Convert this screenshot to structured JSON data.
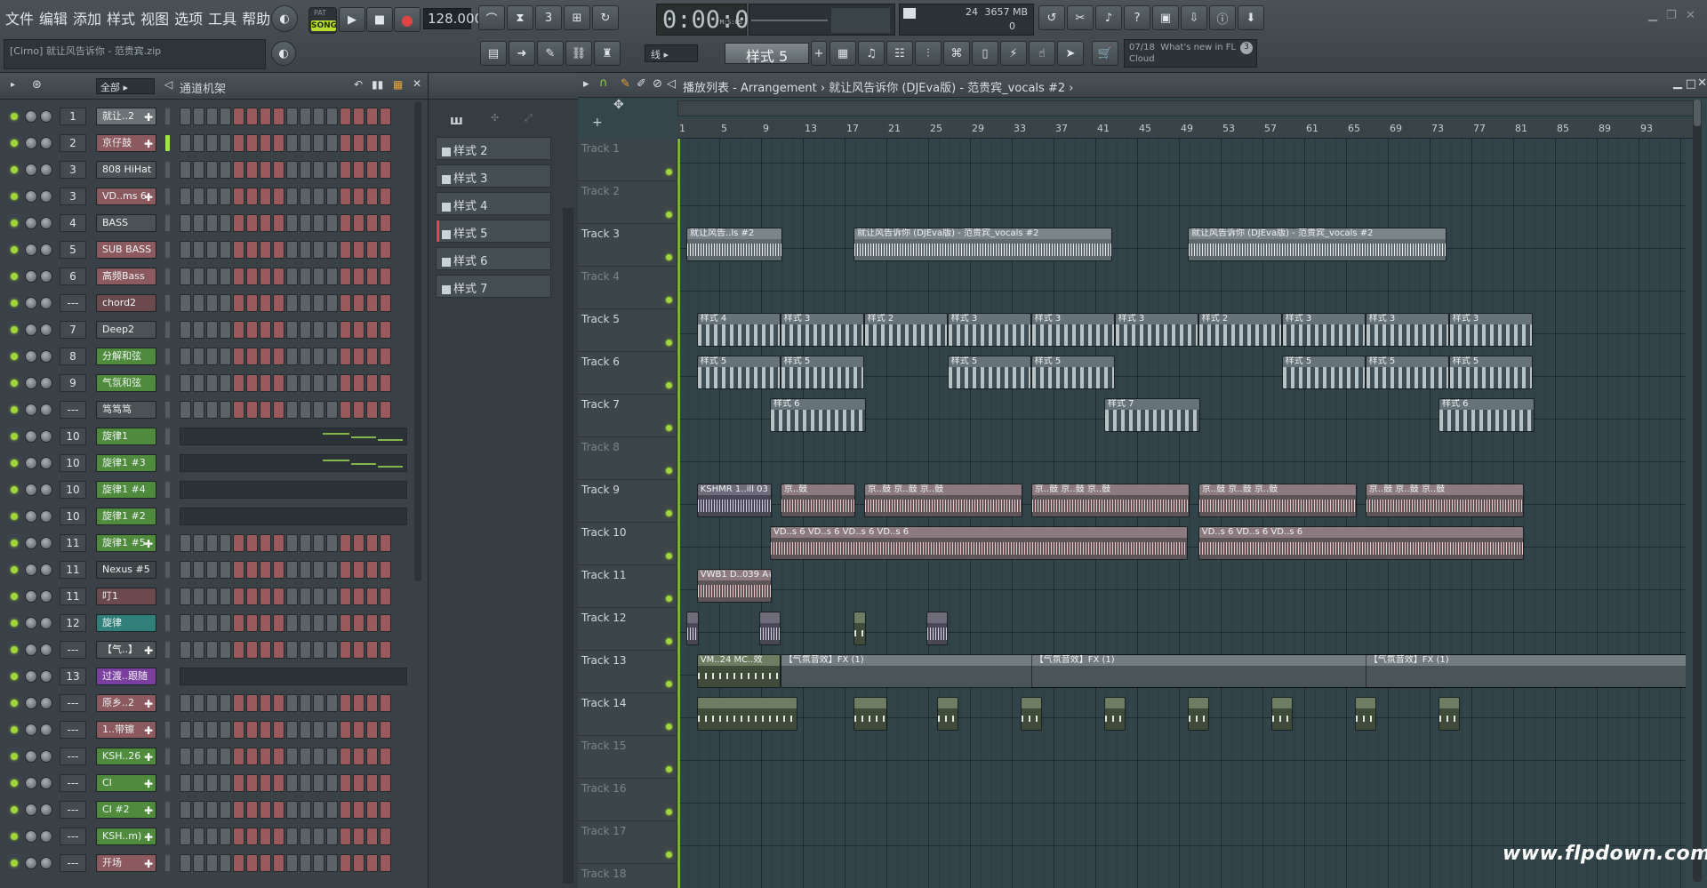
{
  "menu": [
    "文件",
    "编辑",
    "添加",
    "样式",
    "视图",
    "选项",
    "工具",
    "帮助"
  ],
  "hint": "[Cirno] 就让风告诉你 - 范贵宾.zip",
  "transport": {
    "mode": "SONG",
    "mode_top": "PAT",
    "tempo": "128.000",
    "time": "0:00:00",
    "time_unit": "M:S:CS"
  },
  "cpu": {
    "value": "24",
    "memory": "3657 MB",
    "poly": "0"
  },
  "snap": "线",
  "pattern_selector": "样式 5",
  "news": {
    "date": "07/18",
    "text": "What's new in FL Cloud",
    "count": "3"
  },
  "rack": {
    "filter": "全部",
    "title": "通道机架",
    "channels": [
      {
        "num": "1",
        "name": "就让..2",
        "color": "#6b7377",
        "plugin": true,
        "pattern": "steps"
      },
      {
        "num": "2",
        "name": "京仔鼓",
        "color": "#8a5a5e",
        "plugin": true,
        "pattern": "steps"
      },
      {
        "num": "3",
        "name": "808 HiHat",
        "color": "#4a5256",
        "plugin": false,
        "pattern": "steps"
      },
      {
        "num": "3",
        "name": "VD..ms 6",
        "color": "#8a5a5e",
        "plugin": true,
        "pattern": "steps"
      },
      {
        "num": "4",
        "name": "BASS",
        "color": "#4a5256",
        "plugin": false,
        "pattern": "steps"
      },
      {
        "num": "5",
        "name": "SUB BASS",
        "color": "#8a5a5e",
        "plugin": false,
        "pattern": "steps"
      },
      {
        "num": "6",
        "name": "高频Bass",
        "color": "#8a5a5e",
        "plugin": false,
        "pattern": "steps"
      },
      {
        "num": "---",
        "name": "chord2",
        "color": "#6b4a4e",
        "plugin": false,
        "pattern": "steps"
      },
      {
        "num": "7",
        "name": "Deep2",
        "color": "#4a5256",
        "plugin": false,
        "pattern": "steps"
      },
      {
        "num": "8",
        "name": "分解和弦",
        "color": "#4f8a3d",
        "plugin": false,
        "pattern": "steps"
      },
      {
        "num": "9",
        "name": "气氛和弦",
        "color": "#4f8a3d",
        "plugin": false,
        "pattern": "steps"
      },
      {
        "num": "---",
        "name": "笃笃笃",
        "color": "#4a5256",
        "plugin": false,
        "pattern": "steps"
      },
      {
        "num": "10",
        "name": "旋律1",
        "color": "#4f8a3d",
        "plugin": false,
        "pattern": "roll"
      },
      {
        "num": "10",
        "name": "旋律1 #3",
        "color": "#4f8a3d",
        "plugin": false,
        "pattern": "roll"
      },
      {
        "num": "10",
        "name": "旋律1 #4",
        "color": "#4f8a3d",
        "plugin": false,
        "pattern": "roll"
      },
      {
        "num": "10",
        "name": "旋律1 #2",
        "color": "#4f8a3d",
        "plugin": false,
        "pattern": "roll"
      },
      {
        "num": "11",
        "name": "旋律1 #5",
        "color": "#4f8a3d",
        "plugin": true,
        "pattern": "steps"
      },
      {
        "num": "11",
        "name": "Nexus #5",
        "color": "#3d4448",
        "plugin": false,
        "pattern": "steps"
      },
      {
        "num": "11",
        "name": "叮1",
        "color": "#6b4a4e",
        "plugin": false,
        "pattern": "steps"
      },
      {
        "num": "12",
        "name": "旋律",
        "color": "#2f7f7a",
        "plugin": false,
        "pattern": "steps"
      },
      {
        "num": "---",
        "name": "【气..】",
        "color": "#4a5256",
        "plugin": true,
        "pattern": "steps"
      },
      {
        "num": "13",
        "name": "过渡..跟随",
        "color": "#7b3fa0",
        "plugin": false,
        "pattern": "roll"
      },
      {
        "num": "---",
        "name": "原乡..2",
        "color": "#8a5a5e",
        "plugin": true,
        "pattern": "steps"
      },
      {
        "num": "---",
        "name": "1..带镲",
        "color": "#8a5a5e",
        "plugin": true,
        "pattern": "steps"
      },
      {
        "num": "---",
        "name": "KSH..26",
        "color": "#4f8a3d",
        "plugin": true,
        "pattern": "steps"
      },
      {
        "num": "---",
        "name": "CI",
        "color": "#4f8a3d",
        "plugin": true,
        "pattern": "steps"
      },
      {
        "num": "---",
        "name": "CI #2",
        "color": "#4f8a3d",
        "plugin": true,
        "pattern": "steps"
      },
      {
        "num": "---",
        "name": "KSH..m)",
        "color": "#4f8a3d",
        "plugin": true,
        "pattern": "steps"
      },
      {
        "num": "---",
        "name": "开场",
        "color": "#8a5a5e",
        "plugin": true,
        "pattern": "steps"
      }
    ]
  },
  "picker": [
    "样式 2",
    "样式 3",
    "样式 4",
    "样式 5",
    "样式 6",
    "样式 7"
  ],
  "playlist": {
    "title": "播放列表 - Arrangement › 就让风告诉你 (DJEva版) - 范贵宾_vocals #2 ›",
    "ruler": [
      "1",
      "5",
      "9",
      "13",
      "17",
      "21",
      "25",
      "29",
      "33",
      "37",
      "41",
      "45",
      "49",
      "53",
      "57",
      "61",
      "65",
      "69",
      "73",
      "77",
      "81",
      "85",
      "89",
      "93"
    ],
    "tracks": [
      "Track 1",
      "Track 2",
      "Track 3",
      "Track 4",
      "Track 5",
      "Track 6",
      "Track 7",
      "Track 8",
      "Track 9",
      "Track 10",
      "Track 11",
      "Track 12",
      "Track 13",
      "Track 14",
      "Track 15",
      "Track 16",
      "Track 17",
      "Track 18"
    ],
    "clips": [
      {
        "track": 3,
        "bar": 1,
        "len": 2.3,
        "style": "audio",
        "label": "就让风告..ls #2"
      },
      {
        "track": 3,
        "bar": 17,
        "len": 6.2,
        "style": "audio",
        "label": "就让风告诉你 (DJEva版) - 范贵宾_vocals #2"
      },
      {
        "track": 3,
        "bar": 49,
        "len": 6.2,
        "style": "audio",
        "label": "就让风告诉你 (DJEva版) - 范贵宾_vocals #2"
      },
      {
        "track": 5,
        "bar": 2,
        "len": 2,
        "style": "pat",
        "label": "样式 4"
      },
      {
        "track": 5,
        "bar": 10,
        "len": 2,
        "style": "pat",
        "label": "样式 3"
      },
      {
        "track": 5,
        "bar": 18,
        "len": 2,
        "style": "pat",
        "label": "样式 2"
      },
      {
        "track": 5,
        "bar": 26,
        "len": 2,
        "style": "pat",
        "label": "样式 3"
      },
      {
        "track": 5,
        "bar": 34,
        "len": 2,
        "style": "pat",
        "label": "样式 3"
      },
      {
        "track": 5,
        "bar": 42,
        "len": 2,
        "style": "pat",
        "label": "样式 3"
      },
      {
        "track": 5,
        "bar": 50,
        "len": 2,
        "style": "pat",
        "label": "样式 2"
      },
      {
        "track": 5,
        "bar": 58,
        "len": 2,
        "style": "pat",
        "label": "样式 3"
      },
      {
        "track": 5,
        "bar": 66,
        "len": 2,
        "style": "pat",
        "label": "样式 3"
      },
      {
        "track": 5,
        "bar": 74,
        "len": 2,
        "style": "pat",
        "label": "样式 3"
      },
      {
        "track": 6,
        "bar": 2,
        "len": 2,
        "style": "pat",
        "label": "样式 5"
      },
      {
        "track": 6,
        "bar": 10,
        "len": 2,
        "style": "pat",
        "label": "样式 5"
      },
      {
        "track": 6,
        "bar": 26,
        "len": 2,
        "style": "pat",
        "label": "样式 5"
      },
      {
        "track": 6,
        "bar": 34,
        "len": 2,
        "style": "pat",
        "label": "样式 5"
      },
      {
        "track": 6,
        "bar": 58,
        "len": 2,
        "style": "pat",
        "label": "样式 5"
      },
      {
        "track": 6,
        "bar": 66,
        "len": 2,
        "style": "pat",
        "label": "样式 5"
      },
      {
        "track": 6,
        "bar": 74,
        "len": 2,
        "style": "pat",
        "label": "样式 5"
      },
      {
        "track": 7,
        "bar": 9,
        "len": 2.3,
        "style": "pat",
        "label": "样式 6"
      },
      {
        "track": 7,
        "bar": 41,
        "len": 2.3,
        "style": "pat",
        "label": "样式 7"
      },
      {
        "track": 7,
        "bar": 73,
        "len": 2.3,
        "style": "pat",
        "label": "样式 6"
      },
      {
        "track": 9,
        "bar": 2,
        "len": 1.8,
        "style": "purple",
        "label": "KSHMR 1..ill 03"
      },
      {
        "track": 9,
        "bar": 10,
        "len": 1.8,
        "style": "pink",
        "label": "京..鼓"
      },
      {
        "track": 9,
        "bar": 18,
        "len": 3.8,
        "style": "pink",
        "label": "京..鼓 京..鼓 京..鼓"
      },
      {
        "track": 9,
        "bar": 34,
        "len": 3.8,
        "style": "pink",
        "label": "京..鼓 京..鼓 京..鼓"
      },
      {
        "track": 9,
        "bar": 50,
        "len": 3.8,
        "style": "pink",
        "label": "京..鼓 京..鼓 京..鼓"
      },
      {
        "track": 9,
        "bar": 66,
        "len": 3.8,
        "style": "pink",
        "label": "京..鼓 京..鼓 京..鼓"
      },
      {
        "track": 10,
        "bar": 9,
        "len": 10,
        "style": "pink",
        "label": "VD..s 6 VD..s 6 VD..s 6 VD..s 6"
      },
      {
        "track": 10,
        "bar": 50,
        "len": 7.8,
        "style": "pink",
        "label": "VD..s 6 VD..s 6 VD..s 6"
      },
      {
        "track": 11,
        "bar": 2,
        "len": 1.8,
        "style": "pink",
        "label": "VWB1 D..039 A#"
      },
      {
        "track": 12,
        "bar": 1,
        "len": 0.3,
        "style": "purple",
        "label": ""
      },
      {
        "track": 12,
        "bar": 8,
        "len": 0.5,
        "style": "purple",
        "label": ""
      },
      {
        "track": 12,
        "bar": 17,
        "len": 0.3,
        "style": "green",
        "label": ""
      },
      {
        "track": 12,
        "bar": 24,
        "len": 0.5,
        "style": "purple",
        "label": ""
      },
      {
        "track": 13,
        "bar": 2,
        "len": 2,
        "style": "green",
        "label": "VM..24 MC..效"
      },
      {
        "track": 13,
        "bar": 10,
        "len": 15.9,
        "style": "fx",
        "label": "【气氛音效】FX (1)"
      },
      {
        "track": 13,
        "bar": 34,
        "len": 16,
        "style": "fx",
        "label": "【气氛音效】FX (1)"
      },
      {
        "track": 13,
        "bar": 66,
        "len": 8,
        "style": "fx",
        "label": "【气氛音效】FX (1)"
      },
      {
        "track": 14,
        "bar": 2,
        "len": 2.4,
        "style": "green",
        "label": ""
      },
      {
        "track": 14,
        "bar": 17,
        "len": 0.8,
        "style": "green",
        "label": ""
      },
      {
        "track": 14,
        "bar": 25,
        "len": 0.5,
        "style": "green",
        "label": ""
      },
      {
        "track": 14,
        "bar": 33,
        "len": 0.5,
        "style": "green",
        "label": ""
      },
      {
        "track": 14,
        "bar": 41,
        "len": 0.5,
        "style": "green",
        "label": ""
      },
      {
        "track": 14,
        "bar": 49,
        "len": 0.5,
        "style": "green",
        "label": ""
      },
      {
        "track": 14,
        "bar": 57,
        "len": 0.5,
        "style": "green",
        "label": ""
      },
      {
        "track": 14,
        "bar": 65,
        "len": 0.5,
        "style": "green",
        "label": ""
      },
      {
        "track": 14,
        "bar": 73,
        "len": 0.5,
        "style": "green",
        "label": ""
      }
    ]
  },
  "watermark": "www.flpdown.com"
}
